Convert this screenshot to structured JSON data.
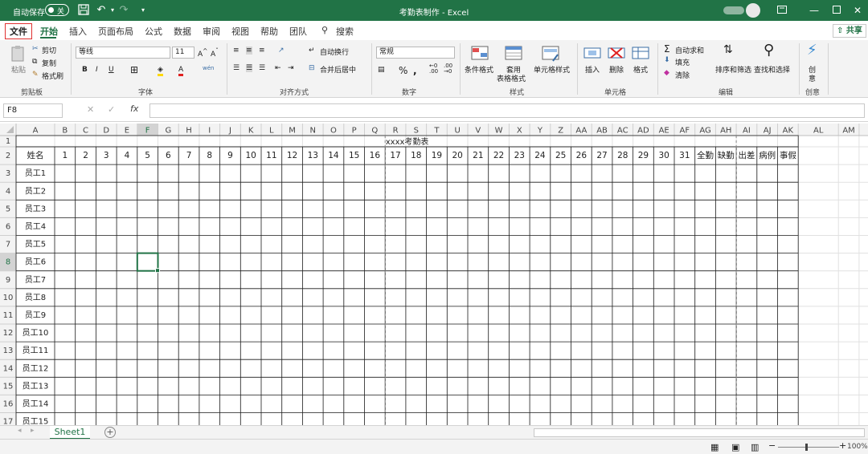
{
  "titlebar": {
    "autosave_label": "自动保存",
    "autosave_state": "关",
    "doc_title": "考勤表制作 - Excel",
    "window_controls": [
      "minimize",
      "restore",
      "maximize",
      "close"
    ]
  },
  "tabs": [
    "文件",
    "开始",
    "插入",
    "页面布局",
    "公式",
    "数据",
    "审阅",
    "视图",
    "帮助",
    "团队"
  ],
  "search_label": "搜索",
  "share_label": "共享",
  "ribbon": {
    "clipboard": {
      "paste": "粘贴",
      "cut": "剪切",
      "copy": "复制",
      "format_painter": "格式刷",
      "group": "剪贴板"
    },
    "font": {
      "name": "等线",
      "size": "11",
      "group": "字体"
    },
    "alignment": {
      "wrap": "自动换行",
      "merge": "合并后居中",
      "group": "对齐方式"
    },
    "number": {
      "format": "常规",
      "group": "数字"
    },
    "styles": {
      "conditional": "条件格式",
      "table_l1": "套用",
      "table_l2": "表格格式",
      "cell_styles": "单元格样式",
      "group": "样式"
    },
    "cells": {
      "insert": "插入",
      "delete": "删除",
      "format": "格式",
      "group": "单元格"
    },
    "editing": {
      "autosum": "自动求和",
      "fill": "填充",
      "clear": "清除",
      "sort": "排序和筛选",
      "find": "查找和选择",
      "group": "编辑"
    },
    "ideas": {
      "l1": "创",
      "l2": "意",
      "group": "创意"
    }
  },
  "formula_bar": {
    "name_box": "F8",
    "fx": "fx",
    "value": ""
  },
  "sheet": {
    "col_headers": [
      "A",
      "B",
      "C",
      "D",
      "E",
      "F",
      "G",
      "H",
      "I",
      "J",
      "K",
      "L",
      "M",
      "N",
      "O",
      "P",
      "Q",
      "R",
      "S",
      "T",
      "U",
      "V",
      "W",
      "X",
      "Y",
      "Z",
      "AA",
      "AB",
      "AC",
      "AD",
      "AE",
      "AF",
      "AG",
      "AH",
      "AI",
      "AJ",
      "AK",
      "AL",
      "AM"
    ],
    "row_headers": [
      "1",
      "2",
      "3",
      "4",
      "5",
      "6",
      "7",
      "8",
      "9",
      "10",
      "11",
      "12",
      "13",
      "14",
      "15",
      "16",
      "17"
    ],
    "title_cell": "xxxx考勤表",
    "header_row": [
      "姓名",
      "1",
      "2",
      "3",
      "4",
      "5",
      "6",
      "7",
      "8",
      "9",
      "10",
      "11",
      "12",
      "13",
      "14",
      "15",
      "16",
      "17",
      "18",
      "19",
      "20",
      "21",
      "22",
      "23",
      "24",
      "25",
      "26",
      "27",
      "28",
      "29",
      "30",
      "31",
      "全勤",
      "缺勤",
      "出差",
      "病例",
      "事假"
    ],
    "employees": [
      "员工1",
      "员工2",
      "员工3",
      "员工4",
      "员工5",
      "员工6",
      "员工7",
      "员工8",
      "员工9",
      "员工10",
      "员工11",
      "员工12",
      "员工13",
      "员工14",
      "员工15"
    ],
    "selected_cell": "F8",
    "accent": "#217346"
  },
  "sheet_tabs": [
    "Sheet1"
  ],
  "status": {
    "zoom": "100%"
  }
}
